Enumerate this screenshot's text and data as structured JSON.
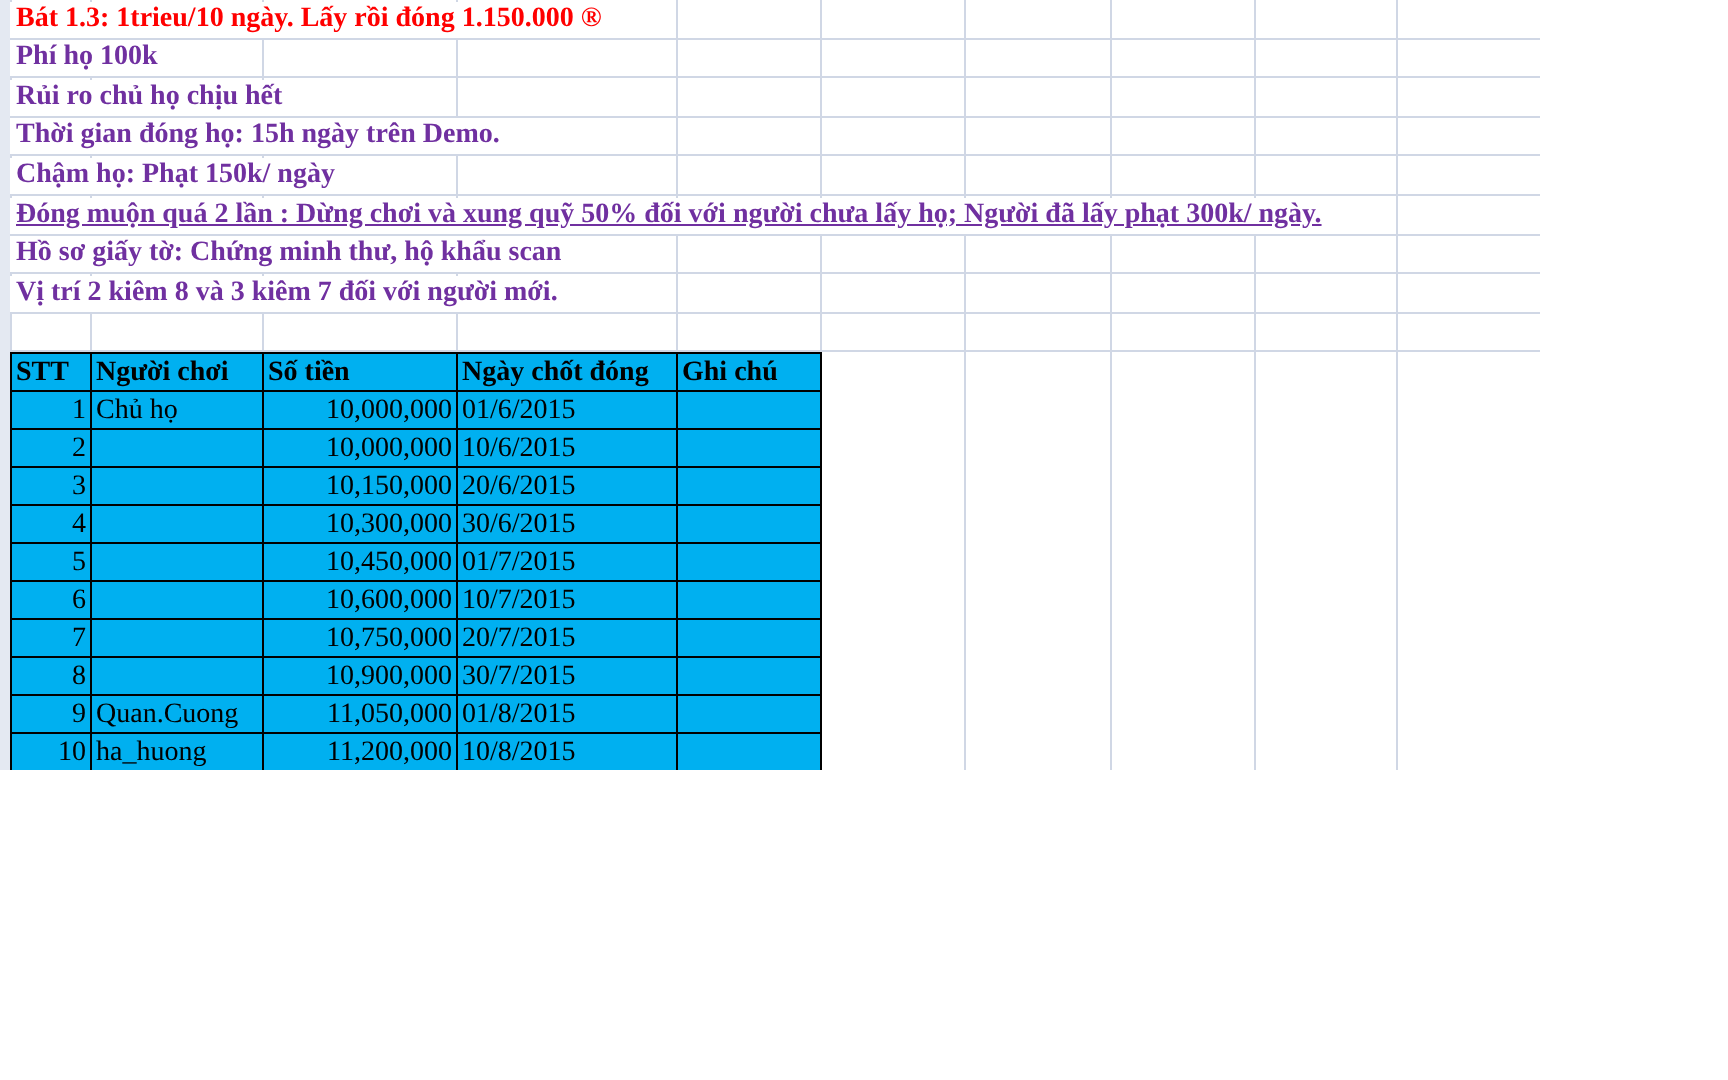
{
  "notes": [
    {
      "text": "Bát 1.3: 1trieu/10 ngày. Lấy rồi đóng 1.150.000 ®",
      "color": "#ff0000",
      "underline": false
    },
    {
      "text": "Phí họ 100k",
      "color": "#7030a0",
      "underline": false
    },
    {
      "text": "Rủi ro chủ họ chịu hết",
      "color": "#7030a0",
      "underline": false
    },
    {
      "text": "Thời gian đóng họ: 15h ngày trên Demo.",
      "color": "#7030a0",
      "underline": false
    },
    {
      "text": "Chậm họ: Phạt 150k/ ngày",
      "color": "#7030a0",
      "underline": false
    },
    {
      "text": "Đóng muộn quá 2 lần : Dừng chơi và xung quỹ 50% đối với người chưa lấy họ; Người đã lấy phạt 300k/ ngày.",
      "color": "#7030a0",
      "underline": true
    },
    {
      "text": "Hồ sơ giấy tờ: Chứng minh thư, hộ khẩu scan",
      "color": "#7030a0",
      "underline": false
    },
    {
      "text": "Vị trí 2 kiêm 8 và 3 kiêm 7 đối với người mới.",
      "color": "#7030a0",
      "underline": false
    }
  ],
  "table": {
    "columns": [
      "STT",
      "Người chơi",
      "Số tiền",
      "Ngày chốt đóng",
      "Ghi chú"
    ],
    "rows": [
      [
        "1",
        "Chủ họ",
        "10,000,000",
        "01/6/2015",
        ""
      ],
      [
        "2",
        "",
        "10,000,000",
        "10/6/2015",
        ""
      ],
      [
        "3",
        "",
        "10,150,000",
        "20/6/2015",
        ""
      ],
      [
        "4",
        "",
        "10,300,000",
        "30/6/2015",
        ""
      ],
      [
        "5",
        "",
        "10,450,000",
        "01/7/2015",
        ""
      ],
      [
        "6",
        "",
        "10,600,000",
        "10/7/2015",
        ""
      ],
      [
        "7",
        "",
        "10,750,000",
        "20/7/2015",
        ""
      ],
      [
        "8",
        "",
        "10,900,000",
        "30/7/2015",
        ""
      ],
      [
        "9",
        "Quan.Cuong",
        "11,050,000",
        "01/8/2015",
        ""
      ],
      [
        "10",
        "ha_huong",
        "11,200,000",
        "10/8/2015",
        ""
      ]
    ]
  }
}
